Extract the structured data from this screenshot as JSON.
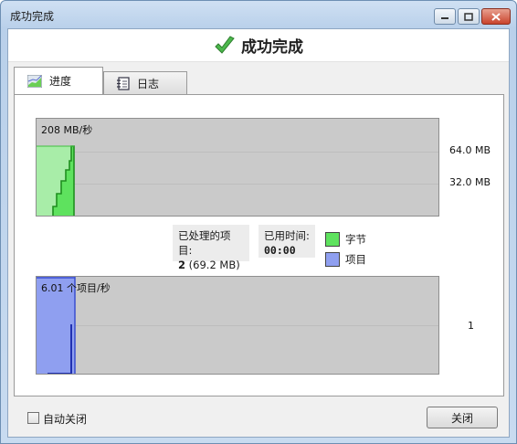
{
  "window": {
    "title": "成功完成"
  },
  "header": {
    "title": "成功完成"
  },
  "tabs": [
    {
      "label": "进度",
      "icon": "progress-chart-icon"
    },
    {
      "label": "日志",
      "icon": "log-notebook-icon"
    }
  ],
  "speed_graph": {
    "rate_label": "208 MB/秒",
    "scale_high": "64.0 MB",
    "scale_low": "32.0 MB"
  },
  "stats": {
    "processed_label": "已处理的项目:",
    "processed_value": "2",
    "processed_size": "(69.2 MB)",
    "elapsed_label": "已用时间:",
    "elapsed_value": "00:00"
  },
  "legend": {
    "bytes_label": "字节",
    "bytes_color": "#5ee25e",
    "items_label": "项目",
    "items_color": "#8f9ff0"
  },
  "items_graph": {
    "rate_label": "6.01 个项目/秒",
    "scale_value": "1"
  },
  "footer": {
    "auto_close_label": "自动关闭",
    "auto_close_checked": false,
    "close_button": "关闭"
  }
}
